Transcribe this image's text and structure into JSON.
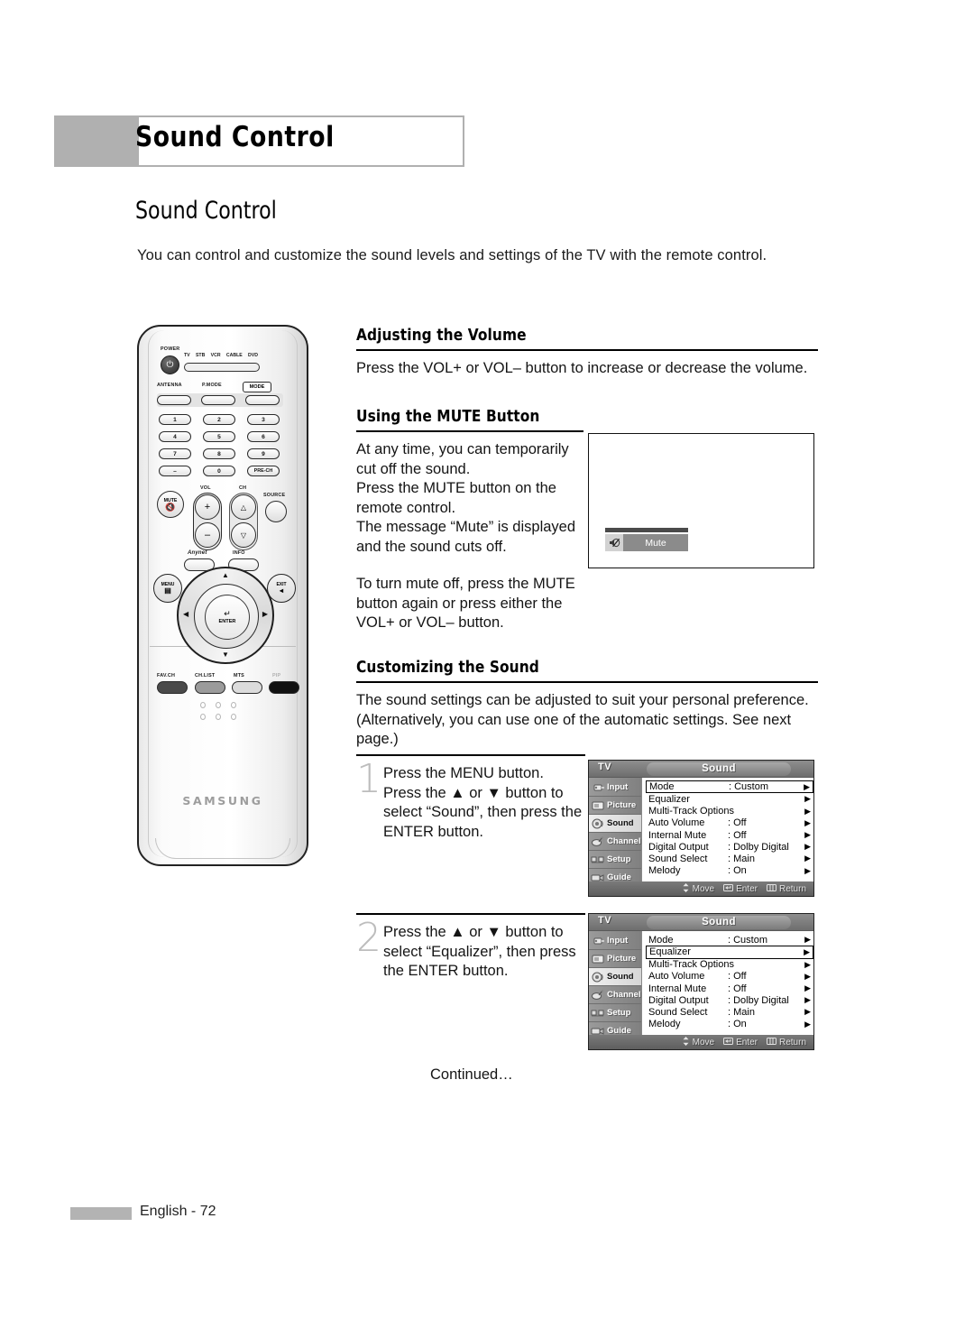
{
  "header": {
    "banner_title": "Sound Control"
  },
  "section": {
    "title": "Sound Control",
    "intro": "You can control and customize the sound levels and settings of the TV with the remote control."
  },
  "adjusting_volume": {
    "heading": "Adjusting the Volume",
    "body": "Press the VOL+ or VOL– button to increase or decrease the volume."
  },
  "mute": {
    "heading": "Using the MUTE Button",
    "body1": "At any time, you can temporarily cut off the sound.\nPress the MUTE button on the remote control.\nThe message “Mute” is displayed and the sound cuts off.",
    "body2": "To turn mute off, press the MUTE button again or press either the VOL+ or VOL– button.",
    "osd_label": "Mute",
    "osd_icon": "mute-speaker-icon"
  },
  "customizing": {
    "heading": "Customizing the Sound",
    "body": "The sound settings can be adjusted to suit your personal preference. (Alternatively, you can use one of the automatic settings. See next page.)"
  },
  "steps": [
    {
      "number": "1",
      "text": "Press the MENU button. Press the ▲ or ▼ button to select “Sound”, then press the ENTER button."
    },
    {
      "number": "2",
      "text": "Press the ▲ or ▼ button to select “Equalizer”, then press the ENTER button."
    }
  ],
  "continued": "Continued…",
  "footer": {
    "page_label": "English - 72"
  },
  "osd_menus": [
    {
      "source_label": "TV",
      "title": "Sound",
      "sidebar": [
        {
          "label": "Input",
          "icon": "input-jack-icon",
          "active": false
        },
        {
          "label": "Picture",
          "icon": "picture-icon",
          "active": false
        },
        {
          "label": "Sound",
          "icon": "speaker-icon",
          "active": true
        },
        {
          "label": "Channel",
          "icon": "satellite-dish-icon",
          "active": false
        },
        {
          "label": "Setup",
          "icon": "setup-icon",
          "active": false
        },
        {
          "label": "Guide",
          "icon": "camcorder-icon",
          "active": false
        }
      ],
      "rows": [
        {
          "label": "Mode",
          "value": ": Custom",
          "selected": true
        },
        {
          "label": "Equalizer",
          "value": "",
          "selected": false
        },
        {
          "label": "Multi-Track Options",
          "value": "",
          "selected": false
        },
        {
          "label": "Auto Volume",
          "value": ": Off",
          "selected": false
        },
        {
          "label": "Internal Mute",
          "value": ": Off",
          "selected": false
        },
        {
          "label": "Digital Output",
          "value": ": Dolby Digital",
          "selected": false
        },
        {
          "label": "Sound Select",
          "value": ": Main",
          "selected": false
        },
        {
          "label": "Melody",
          "value": ": On",
          "selected": false
        }
      ],
      "footer": [
        {
          "glyph": "⬍",
          "label": "Move",
          "icon": "updown-arrow-icon"
        },
        {
          "glyph": "⏎",
          "label": "Enter",
          "icon": "enter-key-icon"
        },
        {
          "glyph": "▤",
          "label": "Return",
          "icon": "return-key-icon"
        }
      ]
    },
    {
      "source_label": "TV",
      "title": "Sound",
      "sidebar": [
        {
          "label": "Input",
          "icon": "input-jack-icon",
          "active": false
        },
        {
          "label": "Picture",
          "icon": "picture-icon",
          "active": false
        },
        {
          "label": "Sound",
          "icon": "speaker-icon",
          "active": true
        },
        {
          "label": "Channel",
          "icon": "satellite-dish-icon",
          "active": false
        },
        {
          "label": "Setup",
          "icon": "setup-icon",
          "active": false
        },
        {
          "label": "Guide",
          "icon": "camcorder-icon",
          "active": false
        }
      ],
      "rows": [
        {
          "label": "Mode",
          "value": ": Custom",
          "selected": false
        },
        {
          "label": "Equalizer",
          "value": "",
          "selected": true
        },
        {
          "label": "Multi-Track Options",
          "value": "",
          "selected": false
        },
        {
          "label": "Auto Volume",
          "value": ": Off",
          "selected": false
        },
        {
          "label": "Internal Mute",
          "value": ": Off",
          "selected": false
        },
        {
          "label": "Digital Output",
          "value": ": Dolby Digital",
          "selected": false
        },
        {
          "label": "Sound Select",
          "value": ": Main",
          "selected": false
        },
        {
          "label": "Melody",
          "value": ": On",
          "selected": false
        }
      ],
      "footer": [
        {
          "glyph": "⬍",
          "label": "Move",
          "icon": "updown-arrow-icon"
        },
        {
          "glyph": "⏎",
          "label": "Enter",
          "icon": "enter-key-icon"
        },
        {
          "glyph": "▤",
          "label": "Return",
          "icon": "return-key-icon"
        }
      ]
    }
  ],
  "remote": {
    "brand": "SAMSUNG",
    "power_label": "POWER",
    "device_labels": [
      "TV",
      "STB",
      "VCR",
      "CABLE",
      "DVD"
    ],
    "fn_row": [
      "ANTENNA",
      "P.MODE",
      "MODE"
    ],
    "mode_box_label": "MODE",
    "keypad": [
      "1",
      "2",
      "3",
      "4",
      "5",
      "6",
      "7",
      "8",
      "9",
      "–",
      "0",
      "PRE-CH"
    ],
    "mute_label": "MUTE",
    "vol_label": "VOL",
    "ch_label": "CH",
    "source_label": "SOURCE",
    "anynet_label": "Anynet",
    "info_label": "INFO",
    "menu_label": "MENU",
    "exit_label": "EXIT",
    "enter_label": "ENTER",
    "bottom_row": [
      "FAV.CH",
      "CH.LIST",
      "MTS",
      "PIP"
    ]
  }
}
